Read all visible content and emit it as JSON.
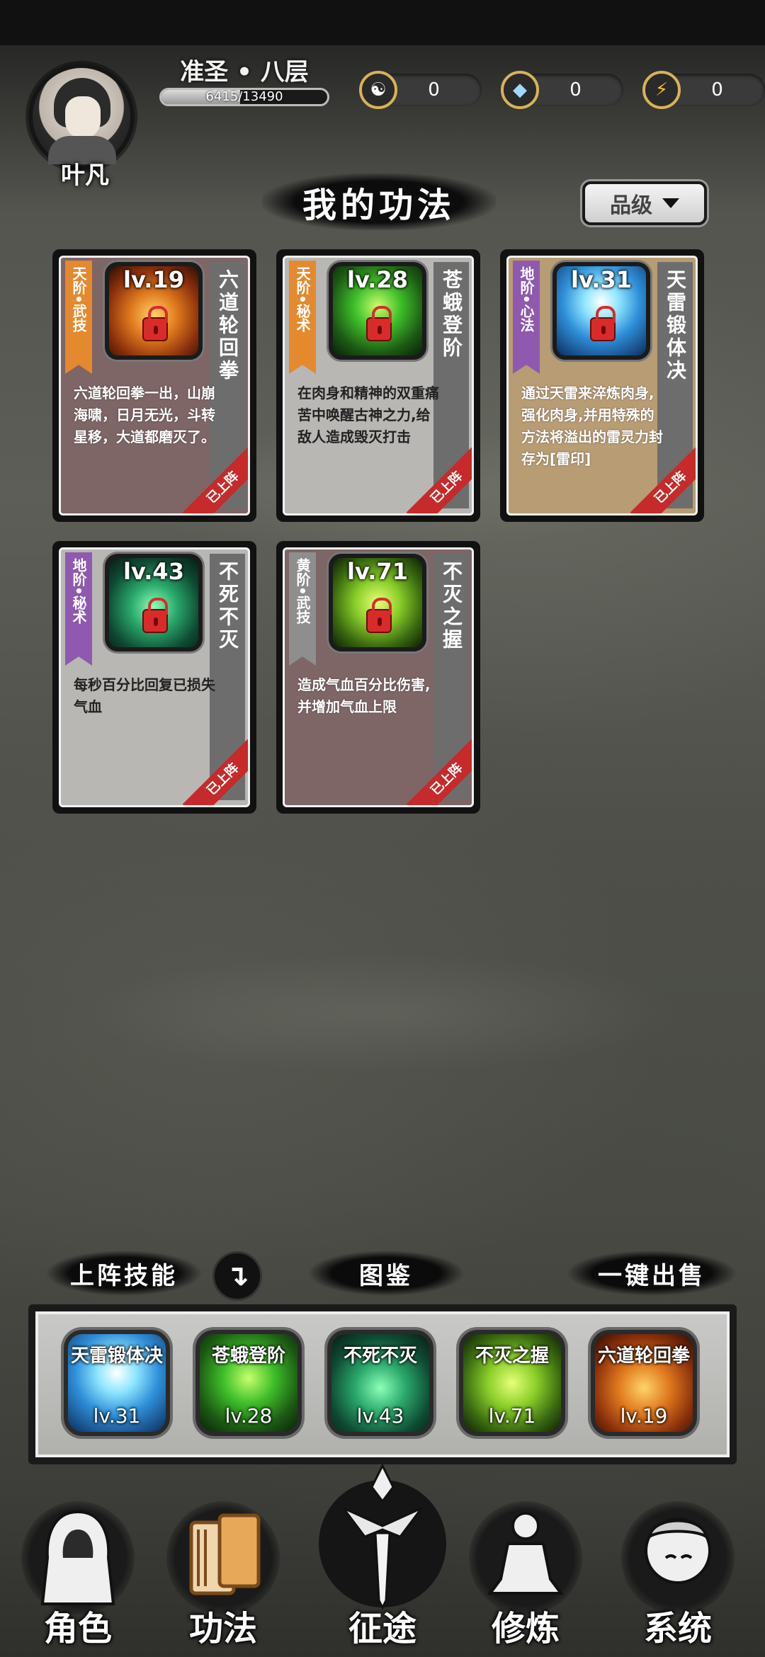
{
  "player": {
    "name": "叶凡",
    "realm": "准圣 • 八层",
    "exp_text": "6415/13490",
    "exp_fraction": 0.4756
  },
  "resources": [
    {
      "icon": "yin-yang-icon",
      "glyph": "☯",
      "value": "0"
    },
    {
      "icon": "crystal-icon",
      "glyph": "◆",
      "value": "0"
    },
    {
      "icon": "lightning-icon",
      "glyph": "⚡",
      "value": "0"
    }
  ],
  "page_title": "我的功法",
  "sort_button": {
    "label": "品级"
  },
  "cards": [
    {
      "grade": "天阶•武技",
      "ribbon": "orange",
      "level": "lv.19",
      "name": "六道轮回拳",
      "desc": "六道轮回拳一出，山崩海啸，日月无光，斗转星移，大道都磨灭了。",
      "tag": "已上阵",
      "theme": "red",
      "art": "fire"
    },
    {
      "grade": "天阶•秘术",
      "ribbon": "orange",
      "level": "lv.28",
      "name": "苍蛾登阶",
      "desc": "在肉身和精神的双重痛苦中唤醒古神之力,给敌人造成毁灭打击",
      "tag": "已上阵",
      "theme": "gray",
      "art": "green"
    },
    {
      "grade": "地阶•心法",
      "ribbon": "purple",
      "level": "lv.31",
      "name": "天雷锻体决",
      "desc": "通过天雷来淬炼肉身,强化肉身,并用特殊的方法将溢出的雷灵力封存为[雷印]",
      "tag": "已上阵",
      "theme": "tan",
      "art": "blue"
    },
    {
      "grade": "地阶•秘术",
      "ribbon": "purple",
      "level": "lv.43",
      "name": "不死不灭",
      "desc": "每秒百分比回复已损失气血",
      "tag": "已上阵",
      "theme": "gray",
      "art": "teal"
    },
    {
      "grade": "黄阶•武技",
      "ribbon": "gray",
      "level": "lv.71",
      "name": "不灭之握",
      "desc": "造成气血百分比伤害,并增加气血上限",
      "tag": "已上阵",
      "theme": "red",
      "art": "lime"
    }
  ],
  "actions": {
    "deploy_label": "上阵技能",
    "collection_label": "图鉴",
    "sell_label": "一键出售",
    "toggle_glyph": "↴"
  },
  "equipped": [
    {
      "name": "天雷锻体决",
      "level": "lv.31",
      "art": "blue"
    },
    {
      "name": "苍蛾登阶",
      "level": "lv.28",
      "art": "green"
    },
    {
      "name": "不死不灭",
      "level": "lv.43",
      "art": "teal"
    },
    {
      "name": "不灭之握",
      "level": "lv.71",
      "art": "lime"
    },
    {
      "name": "六道轮回拳",
      "level": "lv.19",
      "art": "fire"
    }
  ],
  "nav": [
    {
      "label": "角色",
      "icon": "hooded-figure-icon"
    },
    {
      "label": "功法",
      "icon": "scroll-book-icon"
    },
    {
      "label": "征途",
      "icon": "sword-emblem-icon"
    },
    {
      "label": "修炼",
      "icon": "meditating-figure-icon"
    },
    {
      "label": "系统",
      "icon": "spirit-girl-icon"
    }
  ]
}
